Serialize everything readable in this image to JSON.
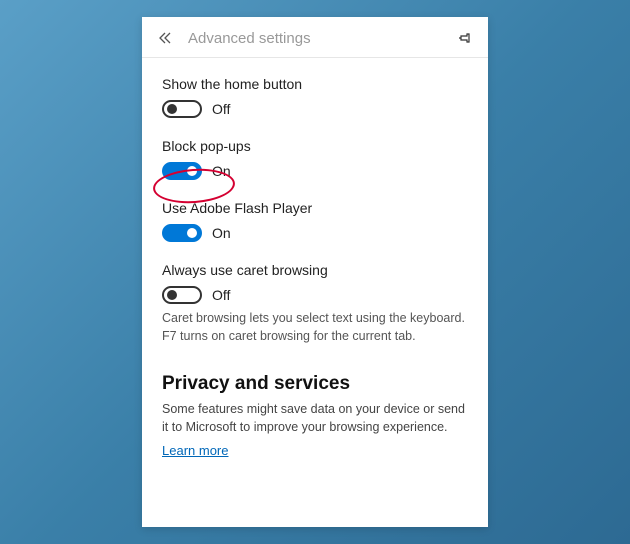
{
  "header": {
    "title": "Advanced settings"
  },
  "settings": {
    "homeButton": {
      "label": "Show the home button",
      "state": "Off",
      "on": false
    },
    "blockPopups": {
      "label": "Block pop-ups",
      "state": "On",
      "on": true
    },
    "flash": {
      "label": "Use Adobe Flash Player",
      "state": "On",
      "on": true
    },
    "caret": {
      "label": "Always use caret browsing",
      "state": "Off",
      "on": false,
      "description": "Caret browsing lets you select text using the keyboard. F7 turns on caret browsing for the current tab."
    }
  },
  "privacy": {
    "title": "Privacy and services",
    "description": "Some features might save data on your device or send it to Microsoft to improve your browsing experience.",
    "link": "Learn more"
  },
  "colors": {
    "accent": "#0078d7",
    "annotation": "#d40031"
  }
}
